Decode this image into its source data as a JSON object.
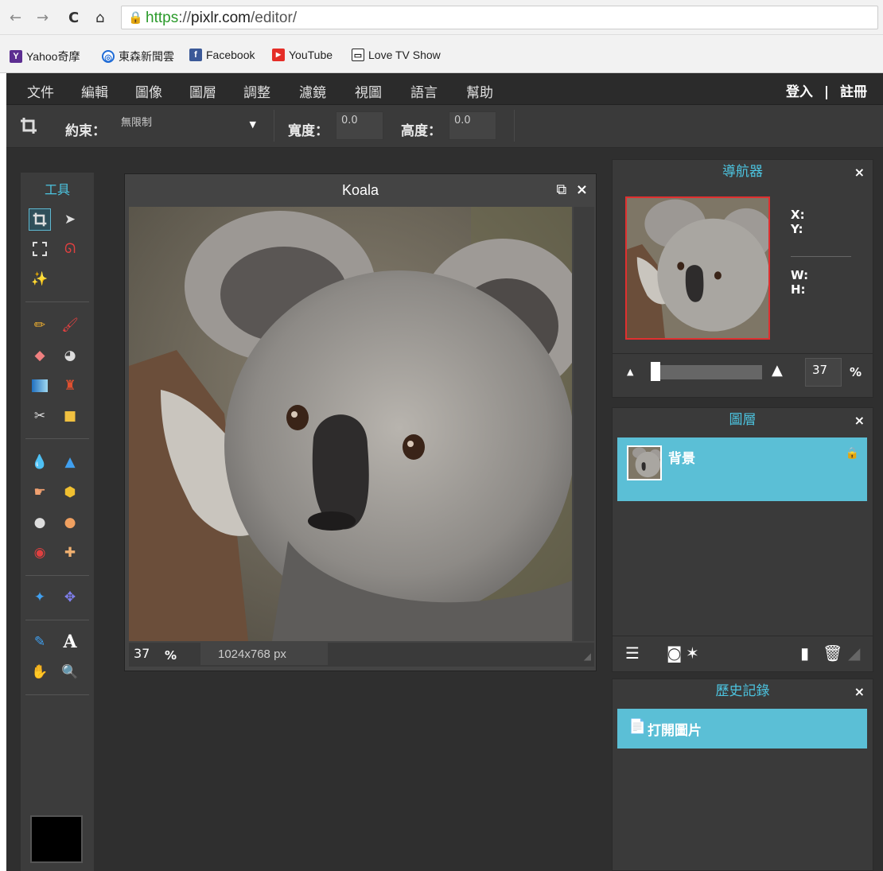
{
  "browser": {
    "nav": {
      "back": "←",
      "forward": "→",
      "reload": "C",
      "home": "⌂"
    },
    "url": {
      "scheme": "https",
      "sep": "://",
      "host": "pixlr.com",
      "path": "/editor/"
    },
    "bookmarks": [
      {
        "label": "Yahoo奇摩",
        "icon": "Y",
        "color": "#5c2d91"
      },
      {
        "label": "東森新聞雲",
        "icon": "◎",
        "color": "#1e6bd6"
      },
      {
        "label": "Facebook",
        "icon": "f",
        "color": "#3b5998"
      },
      {
        "label": "YouTube",
        "icon": "▶",
        "color": "#e52d27"
      },
      {
        "label": "Love TV Show",
        "icon": "▭",
        "color": "#222222"
      }
    ]
  },
  "menu": {
    "items": [
      "文件",
      "編輯",
      "圖像",
      "圖層",
      "調整",
      "濾鏡",
      "視圖",
      "語言",
      "幫助"
    ],
    "login": "登入",
    "divider": "|",
    "register": "註冊"
  },
  "options": {
    "constraint_label": "約束：",
    "constraint_value": "無限制",
    "width_label": "寬度：",
    "width_value": "0.0",
    "height_label": "高度：",
    "height_value": "0.0"
  },
  "tools": {
    "title": "工具",
    "color_hex": "#000000"
  },
  "document": {
    "title": "Koala",
    "restore": "⧉",
    "close": "×",
    "zoom": "37",
    "pct": "%",
    "size": "1024x768 px"
  },
  "navigator": {
    "title": "導航器",
    "close": "×",
    "x_label": "X:",
    "y_label": "Y:",
    "w_label": "W:",
    "h_label": "H:",
    "zoom": "37",
    "pct": "%",
    "zoom_level": 0.37
  },
  "layers": {
    "title": "圖層",
    "close": "×",
    "layer_name": "背景"
  },
  "history": {
    "title": "歷史記錄",
    "close": "×",
    "entry": "打開圖片"
  },
  "colors": {
    "accent": "#4cc4e0",
    "selected_row": "#5bbfd6",
    "panel": "#3a3a3a",
    "workspace": "#2f2f2f"
  }
}
